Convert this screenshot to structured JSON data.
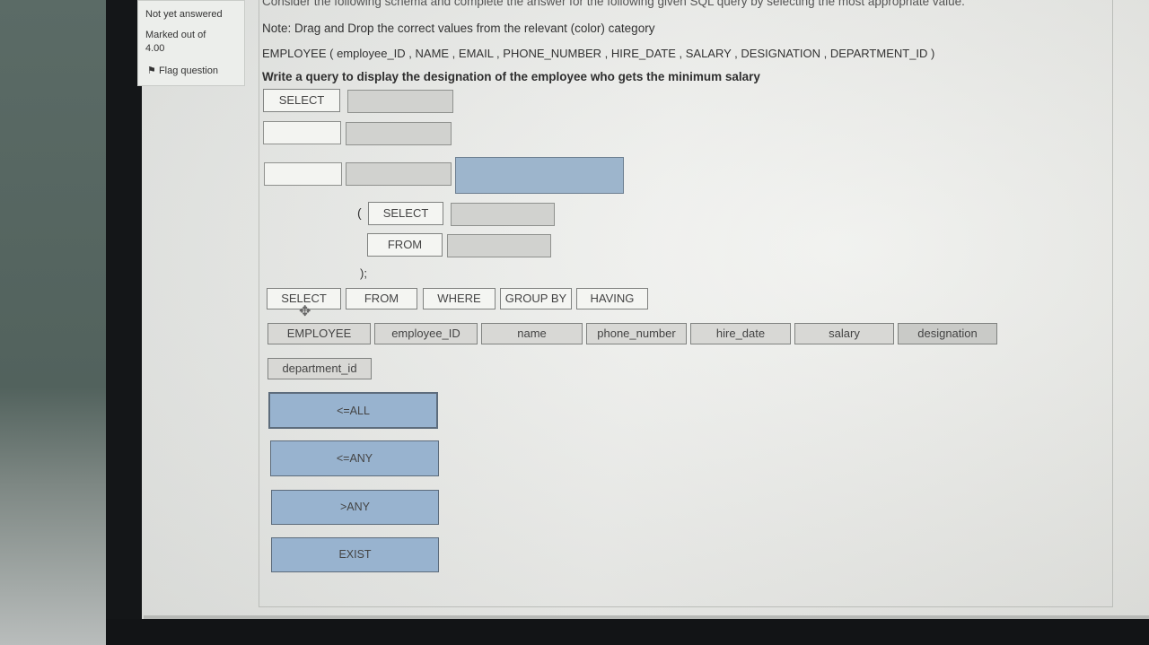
{
  "sidebar": {
    "status": "Not yet answered",
    "marked_label": "Marked out of",
    "marked_value": "4.00",
    "flag_label": "Flag question"
  },
  "question": {
    "intro": "Consider the following schema and complete the answer for the following given SQL query by selecting the most appropriate value.",
    "note": "Note: Drag and Drop the correct values from the relevant (color) category",
    "schema": "EMPLOYEE ( employee_ID , NAME , EMAIL , PHONE_NUMBER , HIRE_DATE , SALARY , DESIGNATION , DEPARTMENT_ID )",
    "prompt": "Write a query to display the designation of the employee who gets the minimum salary"
  },
  "answer_area": {
    "select_1": "SELECT",
    "open_paren": "(",
    "select_2": "SELECT",
    "from_label": "FROM",
    "close_paren": ");"
  },
  "keywords": [
    "SELECT",
    "FROM",
    "WHERE",
    "GROUP BY",
    "HAVING"
  ],
  "columns": [
    "EMPLOYEE",
    "employee_ID",
    "name",
    "phone_number",
    "hire_date",
    "salary",
    "designation"
  ],
  "columns_extra": "department_id",
  "operators": [
    "<=ALL",
    "<=ANY",
    ">ANY",
    "EXIST"
  ],
  "colors": {
    "blue_category": "#98b3cf",
    "gray_category": "#d1d2cf",
    "screen_bg": "#eeefec"
  }
}
